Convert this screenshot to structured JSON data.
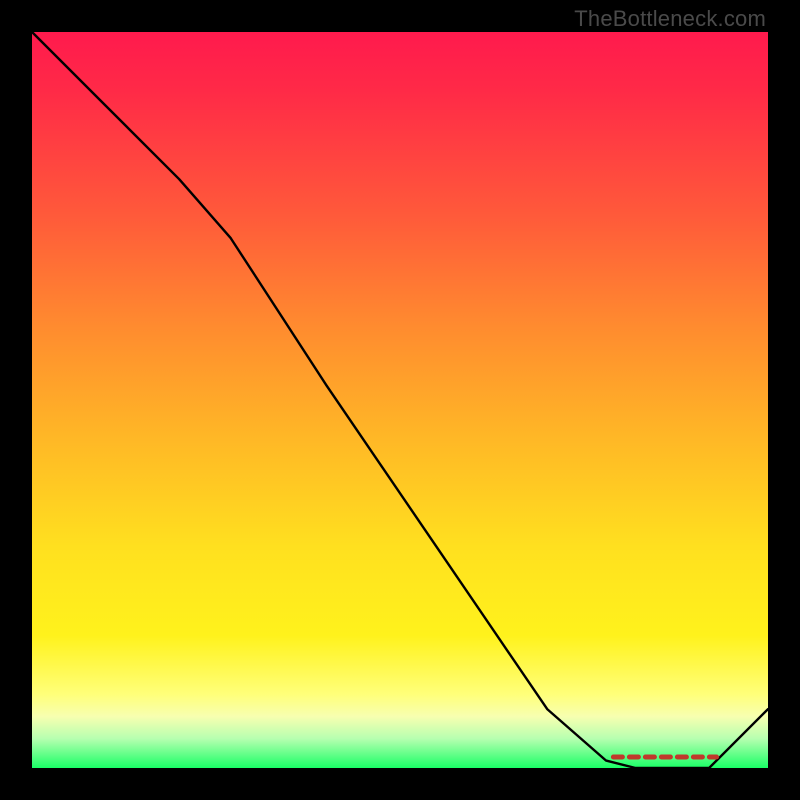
{
  "watermark": "TheBottleneck.com",
  "colors": {
    "gradient_top": "#ff1a4d",
    "gradient_mid_orange": "#ff8b2f",
    "gradient_mid_yellow": "#ffe01f",
    "gradient_bottom": "#1aff66",
    "background": "#000000",
    "curve": "#000000",
    "low_band": "#c0392b"
  },
  "chart_data": {
    "type": "line",
    "title": "",
    "xlabel": "",
    "ylabel": "",
    "xlim": [
      0,
      1
    ],
    "ylim": [
      0,
      1
    ],
    "notes": "No axes or ticks shown. Curve represents some metric that starts high at x=0, decreases with a slope change near x≈0.27, reaches a near-flat minimum (~0) around x≈0.8–0.92 where a small dashed/dotted red marker band sits, then rises again toward x=1. Background is a vertical red→orange→yellow→green gradient.",
    "series": [
      {
        "name": "curve",
        "x": [
          0.0,
          0.1,
          0.2,
          0.27,
          0.4,
          0.55,
          0.7,
          0.78,
          0.82,
          0.88,
          0.92,
          1.0
        ],
        "values": [
          1.0,
          0.9,
          0.8,
          0.72,
          0.52,
          0.3,
          0.08,
          0.01,
          0.0,
          0.0,
          0.0,
          0.08
        ]
      }
    ],
    "low_region": {
      "x_start": 0.79,
      "x_end": 0.93,
      "y": 0.015
    }
  }
}
